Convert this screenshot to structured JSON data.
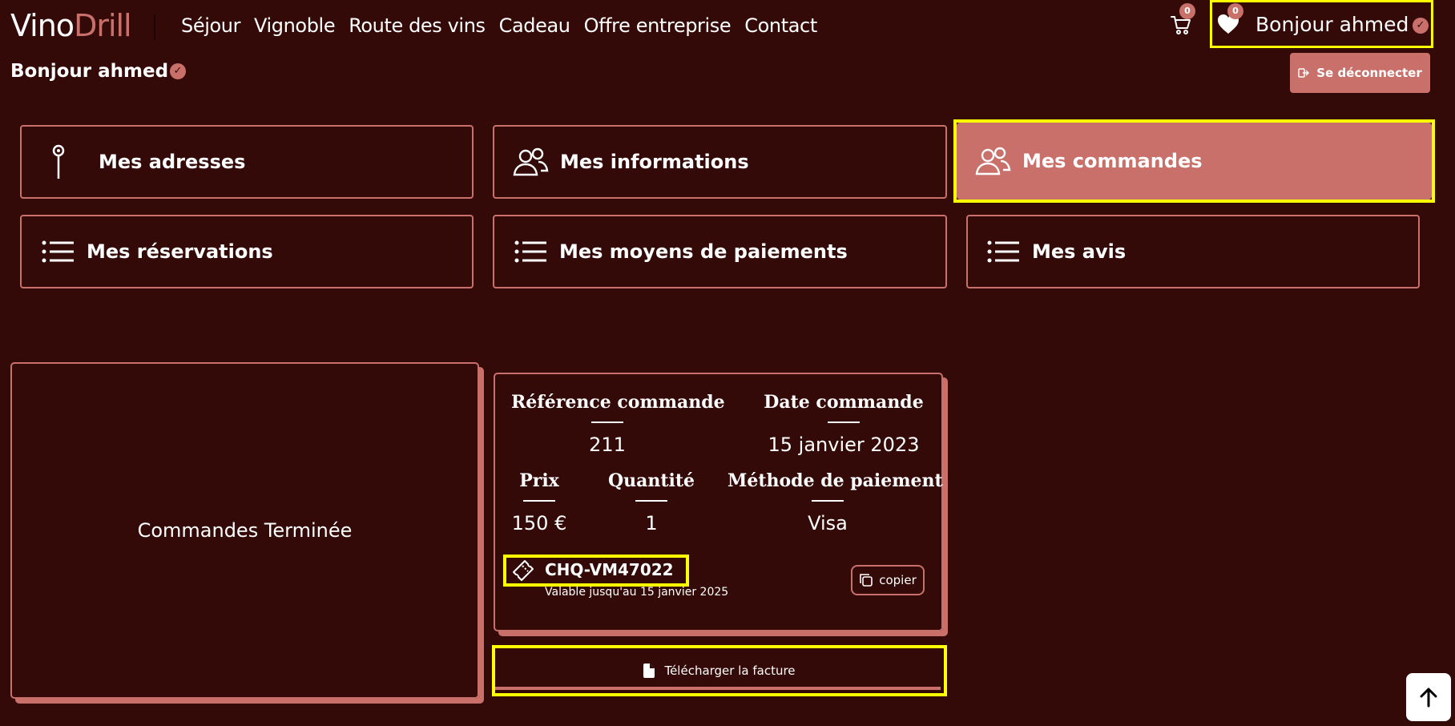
{
  "header": {
    "logo_part1": "Vino",
    "logo_part2": "Drill",
    "nav": [
      "Séjour",
      "Vignoble",
      "Route des vins",
      "Cadeau",
      "Offre entreprise",
      "Contact"
    ],
    "cart_count": "0",
    "wishlist_count": "0",
    "greeting": "Bonjour ahmed"
  },
  "account": {
    "greeting": "Bonjour ahmed",
    "logout_label": "Se déconnecter"
  },
  "tiles": [
    {
      "label": "Mes adresses",
      "icon": "pin-icon",
      "active": false
    },
    {
      "label": "Mes informations",
      "icon": "users-icon",
      "active": false
    },
    {
      "label": "Mes commandes",
      "icon": "users-icon",
      "active": true
    },
    {
      "label": "Mes réservations",
      "icon": "list-icon",
      "active": false
    },
    {
      "label": "Mes moyens de paiements",
      "icon": "list-icon",
      "active": false
    },
    {
      "label": "Mes avis",
      "icon": "list-icon",
      "active": false
    }
  ],
  "orders": {
    "completed_label": "Commandes Terminée",
    "card": {
      "ref_label": "Référence commande",
      "ref_value": "211",
      "date_label": "Date commande",
      "date_value": "15 janvier 2023",
      "price_label": "Prix",
      "price_value": "150 €",
      "qty_label": "Quantité",
      "qty_value": "1",
      "method_label": "Méthode de paiement",
      "method_value": "Visa",
      "coupon_code": "CHQ-VM47022",
      "coupon_validity": "Valable jusqu'au 15 janvier 2025",
      "copy_label": "copier"
    },
    "download_label": "Télécharger la facture"
  },
  "colors": {
    "background": "#330a08",
    "accent": "#c9706a",
    "highlight": "#ffff00"
  }
}
